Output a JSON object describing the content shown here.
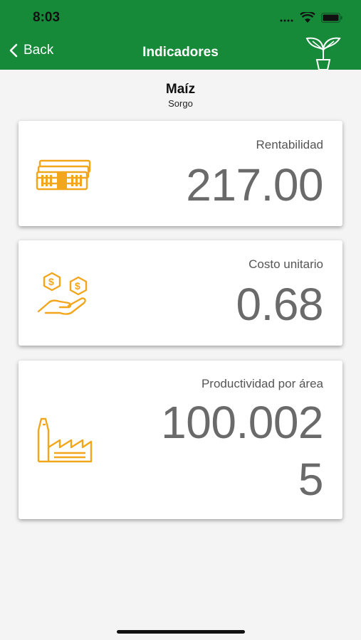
{
  "status_bar": {
    "time": "8:03"
  },
  "nav": {
    "back_label": "Back",
    "title": "Indicadores"
  },
  "crop": {
    "name": "Maíz",
    "subtitle": "Sorgo"
  },
  "cards": [
    {
      "label": "Rentabilidad",
      "value": "217.00",
      "icon": "money-stack-icon"
    },
    {
      "label": "Costo unitario",
      "value": "0.68",
      "icon": "coins-hand-icon"
    },
    {
      "label": "Productividad por área",
      "value_line1": "100.002",
      "value_line2": "5",
      "icon": "factory-icon"
    }
  ],
  "colors": {
    "header": "#178a3a",
    "icon_accent": "#f2a61c",
    "value_text": "#6a6a6a"
  }
}
